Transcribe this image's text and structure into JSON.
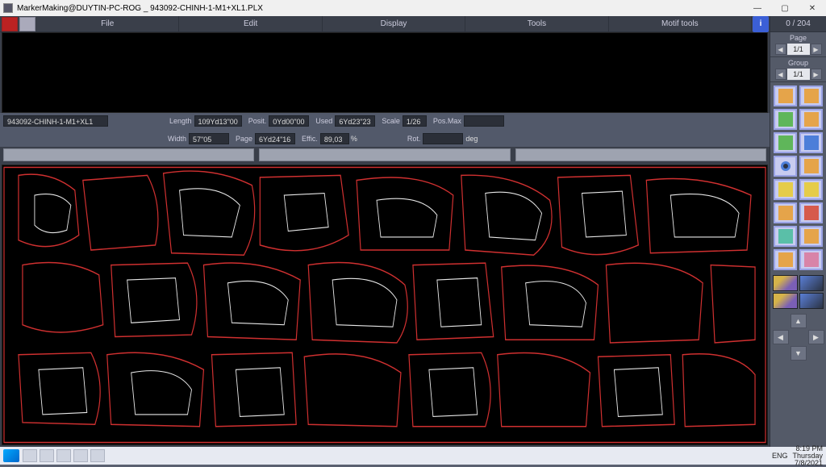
{
  "window": {
    "title": "MarkerMaking@DUYTIN-PC-ROG _ 943092-CHINH-1-M1+XL1.PLX"
  },
  "menubar": {
    "items": [
      "File",
      "Edit",
      "Display",
      "Tools",
      "Motif tools"
    ]
  },
  "counter": {
    "current": 0,
    "total": 204
  },
  "pager": {
    "page_label": "Page",
    "page_value": "1/1",
    "group_label": "Group",
    "group_value": "1/1"
  },
  "info": {
    "name": "943092-CHINH-1-M1+XL1",
    "length_label": "Length",
    "length": "109Yd13\"00",
    "width_label": "Width",
    "width": "57\"05",
    "posit_label": "Posit.",
    "posit": "0Yd00\"00",
    "page_label": "Page",
    "page": "6Yd24\"16",
    "used_label": "Used",
    "used": "6Yd23\"23",
    "effic_label": "Effic.",
    "effic": "89,03",
    "effic_unit": "%",
    "scale_label": "Scale",
    "scale": "1/26",
    "posmax_label": "Pos.Max",
    "posmax": "",
    "rot_label": "Rot.",
    "rot": "",
    "rot_unit": "deg"
  },
  "taskbar": {
    "lang": "ENG",
    "time": "8:19 PM",
    "day": "Thursday",
    "date": "7/8/2021"
  }
}
